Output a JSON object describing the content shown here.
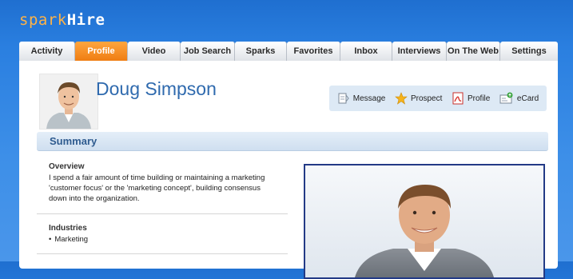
{
  "logo": {
    "part1": "spark",
    "part2": "Hire"
  },
  "tabs": [
    {
      "label": "Activity",
      "width": 70
    },
    {
      "label": "Profile",
      "width": 66,
      "active": true
    },
    {
      "label": "Video",
      "width": 66
    },
    {
      "label": "Job Search",
      "width": 68
    },
    {
      "label": "Sparks",
      "width": 65
    },
    {
      "label": "Favorites",
      "width": 67
    },
    {
      "label": "Inbox",
      "width": 65
    },
    {
      "label": "Interviews",
      "width": 68
    },
    {
      "label": "On The Web",
      "width": 67
    },
    {
      "label": "Settings",
      "width": 72
    }
  ],
  "profile": {
    "name": "Doug Simpson"
  },
  "actions": {
    "message": "Message",
    "prospect": "Prospect",
    "profile": "Profile",
    "ecard": "eCard"
  },
  "summary": {
    "title": "Summary",
    "overview_label": "Overview",
    "overview_lines": [
      "I spend a fair amount of time building or maintaining a marketing",
      "'customer focus' or the 'marketing concept',  building consensus",
      "down into the organization."
    ],
    "industries_label": "Industries",
    "industries": [
      "Marketing"
    ]
  },
  "colors": {
    "accent_orange": "#ef7d12",
    "brand_blue": "#2a7fe0",
    "name_blue": "#2f6aae",
    "photo_border": "#233a86"
  }
}
